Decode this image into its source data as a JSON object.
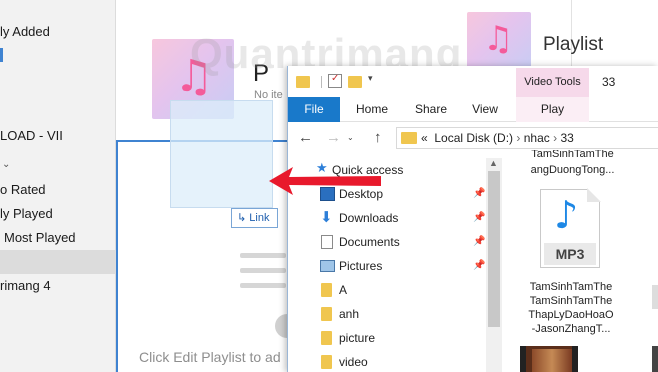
{
  "itunes": {
    "sidebar": {
      "items": [
        {
          "label": "ly Added"
        },
        {
          "label": "LOAD - VII"
        },
        {
          "label": "o Rated"
        },
        {
          "label": "ly Played"
        },
        {
          "label": "Most Played"
        },
        {
          "label": "rimang 4"
        }
      ]
    },
    "playlist_header": "Playlist",
    "playlist_title_partial": "P",
    "playlist_subtitle_partial": "No ite",
    "link_badge": "Link",
    "edit_hint": "Click Edit Playlist to ad"
  },
  "explorer": {
    "title": "33",
    "contextual_tab_group": "Video Tools",
    "ribbon_tabs": [
      "File",
      "Home",
      "Share",
      "View",
      "Play"
    ],
    "address": {
      "separator": "«",
      "path": [
        "Local Disk (D:)",
        "nhac",
        "33"
      ]
    },
    "nav_pane": [
      {
        "label": "Quick access",
        "icon": "star-icon"
      },
      {
        "label": "Desktop",
        "icon": "desktop-icon",
        "pinned": true
      },
      {
        "label": "Downloads",
        "icon": "download-icon",
        "pinned": true
      },
      {
        "label": "Documents",
        "icon": "documents-icon",
        "pinned": true
      },
      {
        "label": "Pictures",
        "icon": "pictures-icon",
        "pinned": true
      },
      {
        "label": "A",
        "icon": "folder-icon"
      },
      {
        "label": "anh",
        "icon": "folder-icon"
      },
      {
        "label": "picture",
        "icon": "folder-icon"
      },
      {
        "label": "video",
        "icon": "folder-icon"
      }
    ],
    "files": [
      {
        "name_lines": [
          "angDuongTong..."
        ]
      },
      {
        "name_lines": [
          "TamSinhTamThe",
          "TamSinhTamThe",
          "ThapLyDaoHoaO",
          "-JasonZhangT..."
        ],
        "type": "MP3"
      }
    ]
  },
  "colors": {
    "file_tab": "#1979ca",
    "video_tools": "#f6d9ea",
    "arrow": "#e8192c",
    "selection_border": "#3f83d1"
  }
}
